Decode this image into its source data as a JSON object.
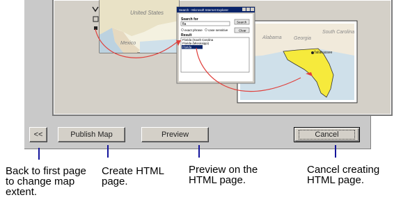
{
  "search_dialog": {
    "title": "Search - Microsoft Internet Explorer",
    "search_for_label": "Search for",
    "search_value": "fla",
    "search_button": "Search",
    "option_exact": "exact phrase",
    "option_case": "case sensitive",
    "clear_button": "Clear",
    "result_label": "Result",
    "results": [
      "Florida (South Carolina",
      "Florida (Mississippi)",
      "Florida"
    ]
  },
  "map_labels": {
    "united_states": "United States",
    "mexico": "Mexico",
    "south_carolina": "South Carolina",
    "georgia": "Georgia",
    "alabama": "Alabama"
  },
  "buttons": {
    "back": "<<",
    "publish": "Publish Map",
    "preview": "Preview",
    "cancel": "Cancel"
  },
  "annotations": {
    "back": "Back to first page to change map extent.",
    "publish": "Create HTML page.",
    "preview": "Preview on the HTML page.",
    "cancel": "Cancel creating HTML page."
  },
  "colors": {
    "callout": "#14159b",
    "arrow": "#e0403c",
    "highlight_state": "#f6ea3c"
  }
}
